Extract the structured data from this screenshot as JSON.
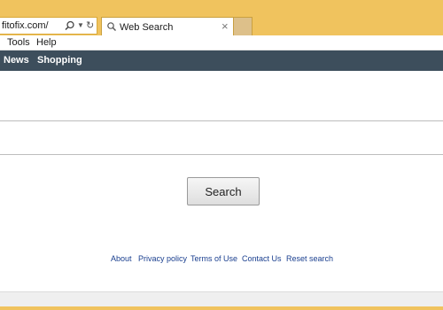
{
  "browser": {
    "address": "fitofix.com/",
    "tab_title": "Web Search",
    "tab_close": "×"
  },
  "menubar": {
    "tools": "Tools",
    "help": "Help"
  },
  "navbar": {
    "news": "News",
    "shopping": "Shopping"
  },
  "main": {
    "search_button": "Search"
  },
  "footer": {
    "about": "About",
    "privacy": "Privacy policy",
    "terms": "Terms of Use",
    "contact": "Contact Us",
    "reset": "Reset search"
  },
  "colors": {
    "chrome": "#f0c35e",
    "navbar": "#3d4e5c",
    "link": "#1a3f8f"
  },
  "icons": {
    "address_search": "search-icon",
    "address_dropdown": "dropdown-arrow-icon",
    "address_refresh": "refresh-icon",
    "tab": "search-icon",
    "tab_close": "close-icon"
  }
}
